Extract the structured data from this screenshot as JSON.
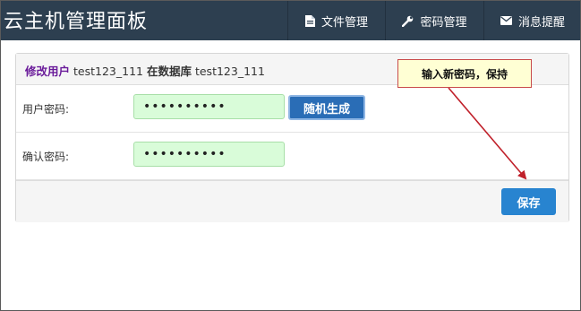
{
  "header": {
    "title": "云主机管理面板",
    "nav": [
      {
        "label": "文件管理",
        "icon": "file-icon"
      },
      {
        "label": "密码管理",
        "icon": "wrench-icon"
      },
      {
        "label": "消息提醒",
        "icon": "envelope-icon"
      }
    ]
  },
  "panel": {
    "title_prefix": "修改用户",
    "username": "test123_111",
    "title_mid": "在数据库",
    "database": "test123_111"
  },
  "form": {
    "password_label": "用户密码:",
    "password_value": "••••••••••",
    "confirm_label": "确认密码:",
    "confirm_value": "••••••••••",
    "random_button": "随机生成",
    "save_button": "保存"
  },
  "annotation": {
    "text": "输入新密码，保持"
  },
  "colors": {
    "navbar": "#2d3f50",
    "input_bg": "#d9fcd9",
    "primary": "#2884d0",
    "random_button": "#2a6db6",
    "callout_bg": "#ffffd4",
    "arrow": "#c0202a"
  }
}
